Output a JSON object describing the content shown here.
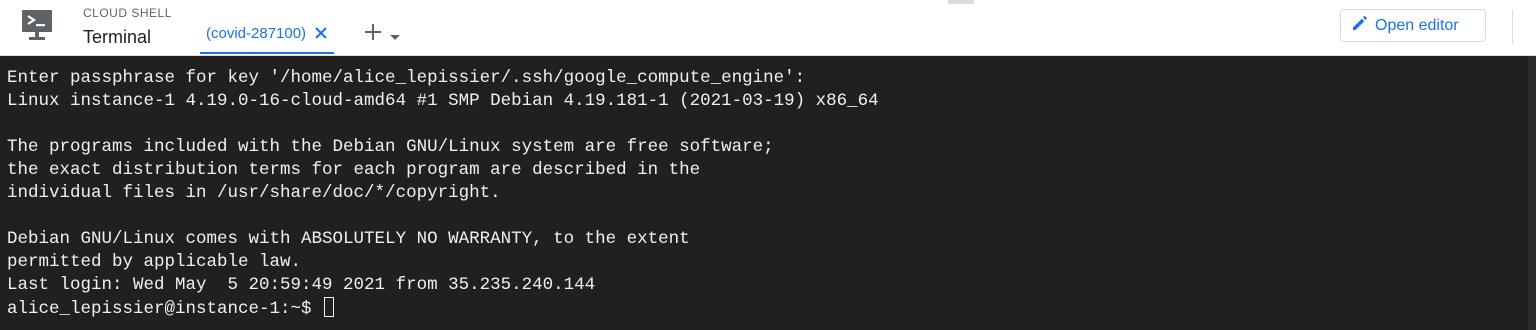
{
  "header": {
    "product_label": "CLOUD SHELL",
    "title": "Terminal",
    "tabs": [
      {
        "label": "(covid-287100)",
        "active": true
      }
    ],
    "open_editor_label": "Open editor"
  },
  "icons": {
    "shell": "cloud-shell-terminal-icon",
    "tab_close": "close-icon",
    "add_tab": "plus-icon",
    "add_dropdown": "chevron-down-icon",
    "edit": "pencil-icon"
  },
  "terminal": {
    "lines": [
      "Enter passphrase for key '/home/alice_lepissier/.ssh/google_compute_engine':",
      "Linux instance-1 4.19.0-16-cloud-amd64 #1 SMP Debian 4.19.181-1 (2021-03-19) x86_64",
      "",
      "The programs included with the Debian GNU/Linux system are free software;",
      "the exact distribution terms for each program are described in the",
      "individual files in /usr/share/doc/*/copyright.",
      "",
      "Debian GNU/Linux comes with ABSOLUTELY NO WARRANTY, to the extent",
      "permitted by applicable law.",
      "Last login: Wed May  5 20:59:49 2021 from 35.235.240.144"
    ],
    "prompt": "alice_lepissier@instance-1:~$ "
  },
  "colors": {
    "accent": "#1a73e8",
    "terminal_bg": "#202020",
    "terminal_fg": "#f0f0f0"
  }
}
